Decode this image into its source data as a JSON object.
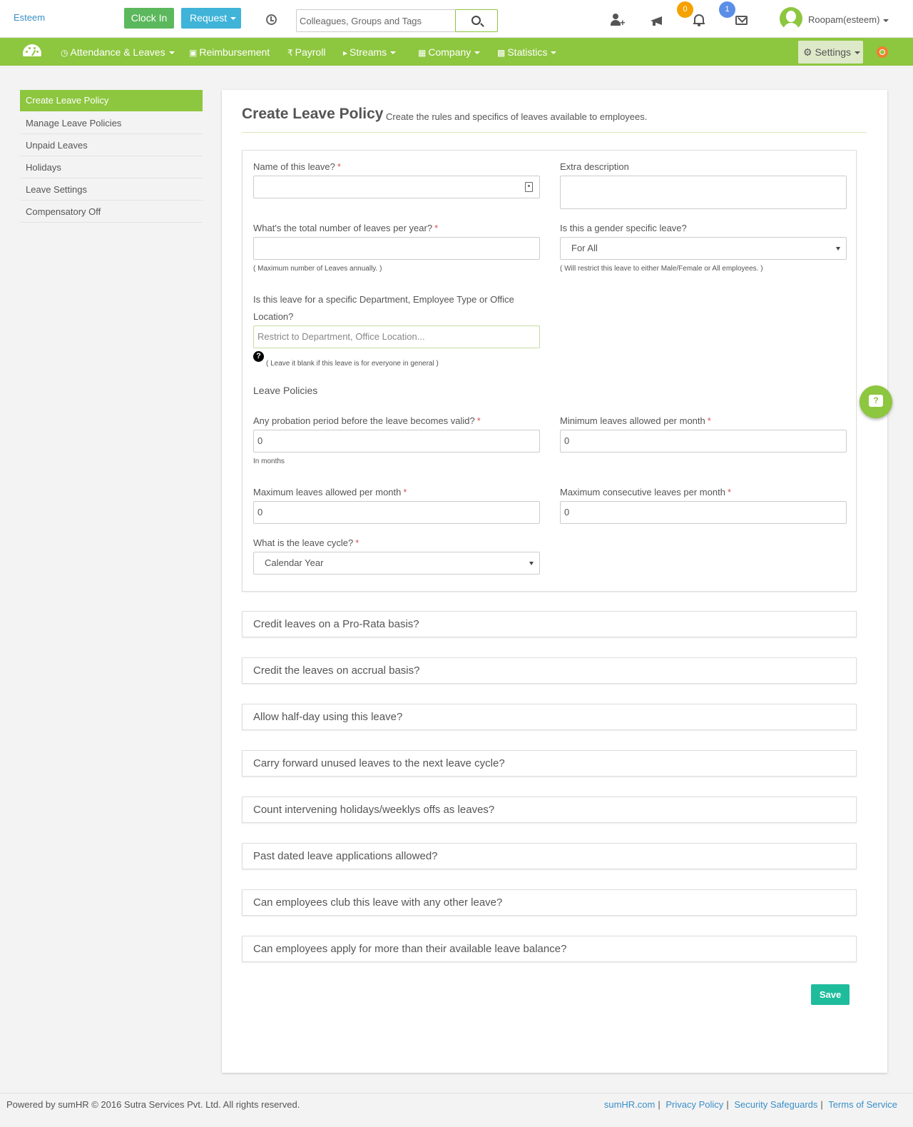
{
  "header": {
    "brand": "Esteem",
    "clock_in": "Clock In",
    "request": "Request",
    "search_placeholder": "Colleagues, Groups and Tags",
    "notifications_count": "0",
    "messages_count": "1",
    "user_name": "Roopam(esteem)"
  },
  "nav": {
    "items": [
      "Attendance & Leaves",
      "Reimbursement",
      "Payroll",
      "Streams",
      "Company",
      "Statistics"
    ],
    "settings": "Settings"
  },
  "sidebar": {
    "items": [
      "Create Leave Policy",
      "Manage Leave Policies",
      "Unpaid Leaves",
      "Holidays",
      "Leave Settings",
      "Compensatory Off"
    ]
  },
  "page": {
    "title": "Create Leave Policy",
    "subtitle": "Create the rules and specifics of leaves available to employees."
  },
  "form": {
    "name_label": "Name of this leave?",
    "extra_desc_label": "Extra description",
    "total_label": "What's the total number of leaves per year?",
    "total_hint": "( Maximum number of Leaves annually. )",
    "gender_label": "Is this a gender specific leave?",
    "gender_value": "For All",
    "gender_hint": "( Will restrict this leave to either Male/Female or All employees. )",
    "dept_label_1": "Is this leave for a specific Department, Employee Type or Office",
    "dept_label_2": "Location?",
    "dept_placeholder": "Restrict to Department, Office Location...",
    "dept_hint": "( Leave it blank if this leave is for everyone in general )",
    "policies_heading": "Leave Policies",
    "probation_label": "Any probation period before the leave becomes valid?",
    "probation_value": "0",
    "probation_hint": "In months",
    "min_month_label": "Minimum leaves allowed per month",
    "min_month_value": "0",
    "max_month_label": "Maximum leaves allowed per month",
    "max_month_value": "0",
    "max_consec_label": "Maximum consecutive leaves per month",
    "max_consec_value": "0",
    "cycle_label": "What is the leave cycle?",
    "cycle_value": "Calendar Year",
    "required_mark": "*",
    "help_mark": "?"
  },
  "accordions": [
    "Credit leaves on a Pro-Rata basis?",
    "Credit the leaves on accrual basis?",
    "Allow half-day using this leave?",
    "Carry forward unused leaves to the next leave cycle?",
    "Count intervening holidays/weeklys offs as leaves?",
    "Past dated leave applications allowed?",
    "Can employees club this leave with any other leave?",
    "Can employees apply for more than their available leave balance?"
  ],
  "save": "Save",
  "footer": {
    "copyright": "Powered by sumHR © 2016 Sutra Services Pvt. Ltd. All rights reserved.",
    "links": [
      "sumHR.com",
      "Privacy Policy",
      "Security Safeguards",
      "Terms of Service"
    ],
    "separator": "|"
  },
  "colors": {
    "brand_green": "#8dc63f",
    "clock_in_green": "#5cb85c",
    "request_blue": "#3fb3d8",
    "save_teal": "#1fbc9c",
    "badge_orange": "#f5a100",
    "badge_blue": "#5b8ee6"
  },
  "icons": [
    "clock-icon",
    "search-icon",
    "add-user-icon",
    "megaphone-icon",
    "bell-icon",
    "mail-icon",
    "avatar",
    "dashboard-icon",
    "gear-icon",
    "lifebuoy-icon",
    "contact-card-icon",
    "help-icon",
    "chat-help-icon"
  ]
}
